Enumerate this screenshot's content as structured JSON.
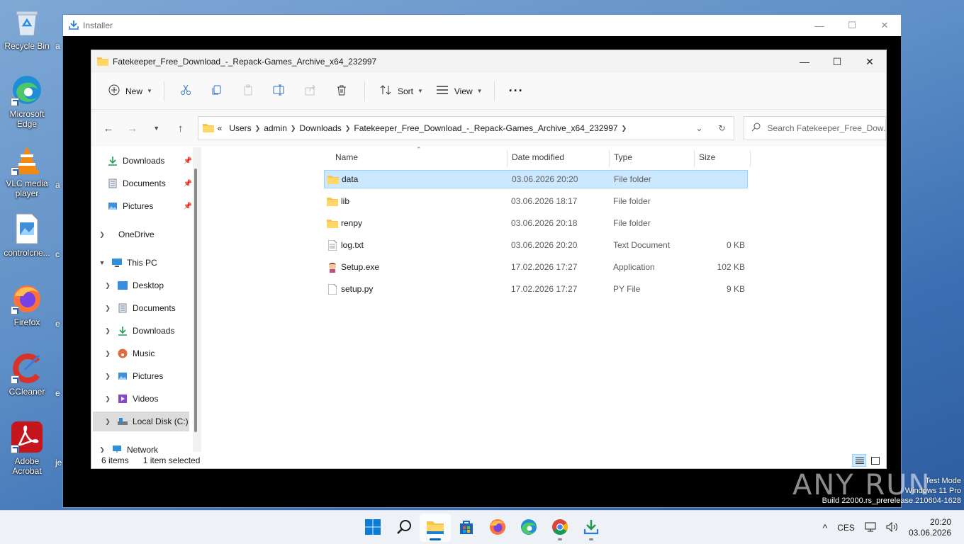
{
  "desktop": {
    "icons": [
      {
        "label": "Recycle Bin",
        "icon": "recycle-bin-icon"
      },
      {
        "label": "Microsoft Edge",
        "icon": "edge-icon"
      },
      {
        "label": "VLC media player",
        "icon": "vlc-icon"
      },
      {
        "label": "controlcne...",
        "icon": "image-file-icon"
      },
      {
        "label": "Firefox",
        "icon": "firefox-icon"
      },
      {
        "label": "CCleaner",
        "icon": "ccleaner-icon"
      },
      {
        "label": "Adobe Acrobat",
        "icon": "acrobat-icon"
      }
    ],
    "slivers": [
      "a",
      "a",
      "c",
      "e",
      "e",
      "je"
    ]
  },
  "installer": {
    "title": "Installer",
    "controls": {
      "minimize": "—",
      "maximize": "☐",
      "close": "✕"
    }
  },
  "explorer": {
    "title": "Fatekeeper_Free_Download_-_Repack-Games_Archive_x64_232997",
    "controls": {
      "minimize": "—",
      "maximize": "☐",
      "close": "✕"
    },
    "command_bar": {
      "new_label": "New",
      "sort_label": "Sort",
      "view_label": "View",
      "more_label": "···"
    },
    "address": {
      "overflow": "«",
      "crumbs": [
        "Users",
        "admin",
        "Downloads",
        "Fatekeeper_Free_Download_-_Repack-Games_Archive_x64_232997"
      ]
    },
    "search": {
      "placeholder": "Search Fatekeeper_Free_Dow..."
    },
    "nav": {
      "quick_access": [
        {
          "label": "Downloads",
          "pinned": true
        },
        {
          "label": "Documents",
          "pinned": true
        },
        {
          "label": "Pictures",
          "pinned": true
        }
      ],
      "onedrive": "OneDrive",
      "this_pc": "This PC",
      "this_pc_children": [
        "Desktop",
        "Documents",
        "Downloads",
        "Music",
        "Pictures",
        "Videos",
        "Local Disk (C:)"
      ],
      "network": "Network"
    },
    "columns": {
      "name": "Name",
      "date": "Date modified",
      "type": "Type",
      "size": "Size"
    },
    "files": [
      {
        "name": "data",
        "date": "03.06.2026 20:20",
        "type": "File folder",
        "size": "",
        "kind": "folder",
        "selected": true
      },
      {
        "name": "lib",
        "date": "03.06.2026 18:17",
        "type": "File folder",
        "size": "",
        "kind": "folder",
        "selected": false
      },
      {
        "name": "renpy",
        "date": "03.06.2026 20:18",
        "type": "File folder",
        "size": "",
        "kind": "folder",
        "selected": false
      },
      {
        "name": "log.txt",
        "date": "03.06.2026 20:20",
        "type": "Text Document",
        "size": "0 KB",
        "kind": "text",
        "selected": false
      },
      {
        "name": "Setup.exe",
        "date": "17.02.2026 17:27",
        "type": "Application",
        "size": "102 KB",
        "kind": "exe",
        "selected": false
      },
      {
        "name": "setup.py",
        "date": "17.02.2026 17:27",
        "type": "PY File",
        "size": "9 KB",
        "kind": "file",
        "selected": false
      }
    ],
    "status": {
      "items": "6 items",
      "selected": "1 item selected"
    }
  },
  "watermark": {
    "text": "ANY RUN",
    "test_mode": [
      "Test Mode",
      "Windows 11 Pro",
      "Build 22000.rs_prerelease.210604-1628"
    ]
  },
  "taskbar": {
    "apps": [
      "start-icon",
      "search-icon",
      "file-explorer-icon",
      "store-icon",
      "firefox-icon",
      "edge-icon",
      "chrome-icon",
      "installer-icon"
    ],
    "tray": {
      "chevron": "^",
      "language": "CES"
    },
    "clock": {
      "time": "20:20",
      "date": "03.06.2026"
    }
  },
  "colors": {
    "accent": "#0067c0",
    "selection_bg": "#cce8ff",
    "selection_border": "#99d1ff",
    "folder_yellow": "#f8c54a"
  }
}
